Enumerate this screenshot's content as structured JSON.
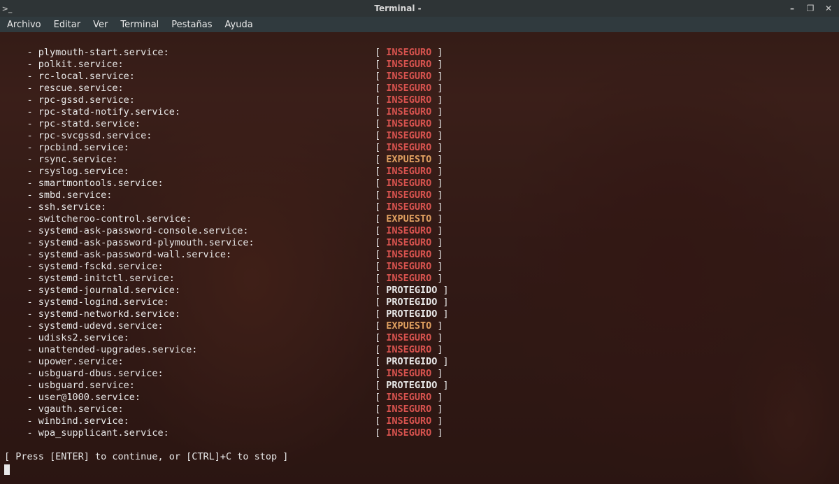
{
  "window": {
    "title": "Terminal -",
    "min_label": "–",
    "max_label": "❐",
    "close_label": "✕",
    "prompt_icon": ">_"
  },
  "menu": {
    "items": [
      "Archivo",
      "Editar",
      "Ver",
      "Terminal",
      "Pestañas",
      "Ayuda"
    ]
  },
  "statuses": {
    "inseguro": "INSEGURO",
    "expuesto": "EXPUESTO",
    "protegido": "PROTEGIDO"
  },
  "services": [
    {
      "name": "plymouth-start.service",
      "status": "inseguro"
    },
    {
      "name": "polkit.service",
      "status": "inseguro"
    },
    {
      "name": "rc-local.service",
      "status": "inseguro"
    },
    {
      "name": "rescue.service",
      "status": "inseguro"
    },
    {
      "name": "rpc-gssd.service",
      "status": "inseguro"
    },
    {
      "name": "rpc-statd-notify.service",
      "status": "inseguro"
    },
    {
      "name": "rpc-statd.service",
      "status": "inseguro"
    },
    {
      "name": "rpc-svcgssd.service",
      "status": "inseguro"
    },
    {
      "name": "rpcbind.service",
      "status": "inseguro"
    },
    {
      "name": "rsync.service",
      "status": "expuesto"
    },
    {
      "name": "rsyslog.service",
      "status": "inseguro"
    },
    {
      "name": "smartmontools.service",
      "status": "inseguro"
    },
    {
      "name": "smbd.service",
      "status": "inseguro"
    },
    {
      "name": "ssh.service",
      "status": "inseguro"
    },
    {
      "name": "switcheroo-control.service",
      "status": "expuesto"
    },
    {
      "name": "systemd-ask-password-console.service",
      "status": "inseguro"
    },
    {
      "name": "systemd-ask-password-plymouth.service",
      "status": "inseguro"
    },
    {
      "name": "systemd-ask-password-wall.service",
      "status": "inseguro"
    },
    {
      "name": "systemd-fsckd.service",
      "status": "inseguro"
    },
    {
      "name": "systemd-initctl.service",
      "status": "inseguro"
    },
    {
      "name": "systemd-journald.service",
      "status": "protegido"
    },
    {
      "name": "systemd-logind.service",
      "status": "protegido"
    },
    {
      "name": "systemd-networkd.service",
      "status": "protegido"
    },
    {
      "name": "systemd-udevd.service",
      "status": "expuesto"
    },
    {
      "name": "udisks2.service",
      "status": "inseguro"
    },
    {
      "name": "unattended-upgrades.service",
      "status": "inseguro"
    },
    {
      "name": "upower.service",
      "status": "protegido"
    },
    {
      "name": "usbguard-dbus.service",
      "status": "inseguro"
    },
    {
      "name": "usbguard.service",
      "status": "protegido"
    },
    {
      "name": "user@1000.service",
      "status": "inseguro"
    },
    {
      "name": "vgauth.service",
      "status": "inseguro"
    },
    {
      "name": "winbind.service",
      "status": "inseguro"
    },
    {
      "name": "wpa_supplicant.service",
      "status": "inseguro"
    }
  ],
  "footer": {
    "prompt": "[ Press [ENTER] to continue, or [CTRL]+C to stop ]"
  }
}
